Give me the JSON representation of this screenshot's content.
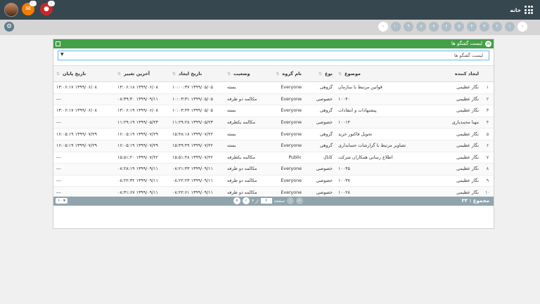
{
  "topbar": {
    "home_label": "خانه",
    "badges": {
      "notifications": "۱۰",
      "alerts": "۱"
    },
    "colors": {
      "bar": "#37474f",
      "orange": "#f57c00",
      "red": "#c62828"
    }
  },
  "breadcrumb": {
    "items": [
      "۱",
      "۲",
      "۳",
      "۴",
      "۵",
      "۶",
      "۷",
      "۸",
      "۹",
      "۱۰"
    ],
    "nav_next": "›",
    "nav_prev": "‹"
  },
  "panel": {
    "title": "لیست گفتگو ها",
    "combo_value": "لیست گفتگو ها",
    "accent": "#43a047"
  },
  "table": {
    "headers": {
      "creator": "ایجاد کننده",
      "subject": "موضوع",
      "type": "نوع",
      "group": "نام گروه",
      "status": "وضعیت",
      "created": "تاریخ ایجاد",
      "modified": "آخرین تغییر",
      "end": "تاریخ پایان"
    },
    "rows": [
      {
        "num": "۱",
        "creator": "نگار عظیمی",
        "subject": "قوانین مرتبط با سازمان",
        "type": "گروهی",
        "group": "Everyone",
        "status": "بسته",
        "created": "۱۳۹۹/۰۵/۰۵ ۱۰:۰۰:۳۷",
        "modified": "۱۳۹۹/۰۶/۰۸ ۱۳:۰۶:۱۸",
        "end": "۱۳۹۹/۰۶/۰۸ ۱۳:۰۶:۱۷"
      },
      {
        "num": "۲",
        "creator": "نگار عظیمی",
        "subject": "۱۰۰۴۰",
        "type": "خصوصی",
        "group": "Everyone",
        "status": "مکالمه دو طرفه",
        "created": "۱۳۹۹/۰۵/۰۵ ۱۰:۰۳:۳۱",
        "modified": "۱۳۹۹/۰۹/۱۱ ۰۸:۳۹:۳۰",
        "end": "---"
      },
      {
        "num": "۳",
        "creator": "نگار عظیمی",
        "subject": "پیشنهادات و انتقادات",
        "type": "گروهی",
        "group": "Everyone",
        "status": "بسته",
        "created": "۱۳۹۹/۰۵/۰۵ ۱۰:۰۳:۴۴",
        "modified": "۱۳۹۹/۰۶/۰۸ ۱۳:۰۶:۱۹",
        "end": "۱۳۹۹/۰۶/۰۸ ۱۳:۰۶:۱۷"
      },
      {
        "num": "۴",
        "creator": "مهنا محمدیاری",
        "subject": "۱۰۰۱۴",
        "type": "خصوصی",
        "group": "Everyone",
        "status": "مکالمه یکطرفه",
        "created": "۱۳۹۹/۰۵/۲۳ ۱۱:۲۹:۲۸",
        "modified": "۱۳۹۹/۰۵/۲۳ ۱۱:۲۹:۱۹",
        "end": "---"
      },
      {
        "num": "۵",
        "creator": "نگار عظیمی",
        "subject": "تحویل فاکتور خرید",
        "type": "گروهی",
        "group": "Everyone",
        "status": "بسته",
        "created": "۱۳۹۹/۰۷/۲۲ ۱۵:۴۸:۱۸",
        "modified": "۱۳۹۹/۰۷/۲۹ ۱۶:۰۵:۱۹",
        "end": "۱۳۹۹/۰۷/۲۹ ۱۶:۰۵:۱۹"
      },
      {
        "num": "۶",
        "creator": "نگار عظیمی",
        "subject": "تصاویر مرتبط با گزارشات حسابداری",
        "type": "گروهی",
        "group": "Everyone",
        "status": "بسته",
        "created": "۱۳۹۹/۰۷/۲۲ ۱۵:۴۹:۴۹",
        "modified": "۱۳۹۹/۰۷/۲۹ ۱۶:۰۵:۱۹",
        "end": "۱۳۹۹/۰۷/۲۹ ۱۶:۰۵:۱۹"
      },
      {
        "num": "۷",
        "creator": "نگار عظیمی",
        "subject": "اطلاع رسانی همکاران شرکت",
        "type": "کانال",
        "group": "Public",
        "status": "مکالمه یکطرفه",
        "created": "۱۳۹۹/۰۷/۲۲ ۱۵:۵۱:۴۸",
        "modified": "۱۳۹۹/۰۷/۲۲ ۱۵:۵۱:۲۰",
        "end": "---"
      },
      {
        "num": "۸",
        "creator": "نگار عظیمی",
        "subject": "۱۰۰۴۵",
        "type": "خصوصی",
        "group": "Everyone",
        "status": "مکالمه دو طرفه",
        "created": "۱۳۹۹/۰۹/۱۱ ۰۸:۲۱:۴۳",
        "modified": "۱۳۹۹/۰۹/۱۱ ۰۸:۲۸:۱۹",
        "end": "---"
      },
      {
        "num": "۹",
        "creator": "نگار عظیمی",
        "subject": "۱۰۰۳۷",
        "type": "خصوصی",
        "group": "Everyone",
        "status": "مکالمه دو طرفه",
        "created": "۱۳۹۹/۰۹/۱۱ ۰۸:۲۲:۲۳",
        "modified": "۱۳۹۹/۰۹/۱۱ ۰۸:۲۲:۳۲",
        "end": "---"
      },
      {
        "num": "۱۰",
        "creator": "نگار عظیمی",
        "subject": "۱۰۰۲۸",
        "type": "خصوصی",
        "group": "Everyone",
        "status": "مکالمه دو طرفه",
        "created": "۱۳۹۹/۰۹/۱۱ ۰۸:۲۲:۶۱",
        "modified": "۱۳۹۹/۰۹/۱۱ ۰۸:۳۱:۶۷",
        "end": "---"
      }
    ]
  },
  "footer": {
    "total": "مجموع : ۳۳",
    "page_label": "صفحه",
    "page_value": "۱",
    "of_label": "از ۴",
    "page_size": "۱۰"
  }
}
